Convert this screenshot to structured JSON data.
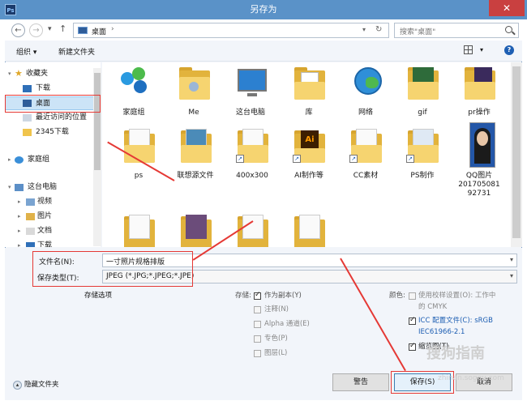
{
  "window": {
    "title": "另存为",
    "app_icon": "Ps",
    "close_glyph": "✕"
  },
  "nav": {
    "back_glyph": "←",
    "forward_glyph": "→",
    "recent_glyph": "▾",
    "up_glyph": "↑",
    "address": "桌面",
    "address_arrow": "›",
    "address_dropdown": "▾",
    "refresh_glyph": "↻",
    "search_placeholder": "搜索\"桌面\""
  },
  "toolbar": {
    "organize": "组织 ▾",
    "new_folder": "新建文件夹",
    "view_arrow": "▾",
    "help_glyph": "?"
  },
  "sidebar": {
    "favorites": "收藏夹",
    "download": "下载",
    "desktop": "桌面",
    "recent": "最近访问的位置",
    "folder_2345": "2345下载",
    "homegroup": "家庭组",
    "this_pc": "这台电脑",
    "videos": "视频",
    "pictures": "图片",
    "documents": "文档",
    "downloads2": "下载"
  },
  "files": [
    {
      "name": "家庭组"
    },
    {
      "name": "Me"
    },
    {
      "name": "这台电脑"
    },
    {
      "name": "库"
    },
    {
      "name": "网络"
    },
    {
      "name": "gif"
    },
    {
      "name": "pr操作"
    },
    {
      "name": "ps"
    },
    {
      "name": "联想源文件"
    },
    {
      "name": "400x300"
    },
    {
      "name": "AI制作等"
    },
    {
      "name": "CC素材"
    },
    {
      "name": "PS制作"
    },
    {
      "name": "QQ图片20170508192731"
    }
  ],
  "fields": {
    "filename_label": "文件名(N):",
    "filename_value": "一寸照片规格排版",
    "filetype_label": "保存类型(T):",
    "filetype_value": "JPEG (*.JPG;*.JPEG;*.JPE)",
    "dropdown_glyph": "▾"
  },
  "options": {
    "section_title": "存储选项",
    "store_label": "存储:",
    "as_copy": "作为副本(Y)",
    "notes": "注释(N)",
    "alpha": "Alpha 通道(E)",
    "spot": "专色(P)",
    "layers": "图层(L)",
    "color_label": "颜色:",
    "proof": "使用校样设置(O): 工作中的 CMYK",
    "icc": "ICC 配置文件(C): sRGB IEC61966-2.1",
    "thumbnail": "缩览图(T)"
  },
  "footer": {
    "hide_folders": "隐藏文件夹",
    "hide_glyph": "▴",
    "warning": "警告",
    "save": "保存(S)",
    "cancel": "取消"
  },
  "watermark": {
    "brand": "搜狗指南",
    "url": "zhinan.sogou.com"
  },
  "colors": {
    "title_bar": "#5a92c8",
    "selection": "#cce4f7",
    "folder": "#f6d470",
    "annotation": "#e53935"
  }
}
